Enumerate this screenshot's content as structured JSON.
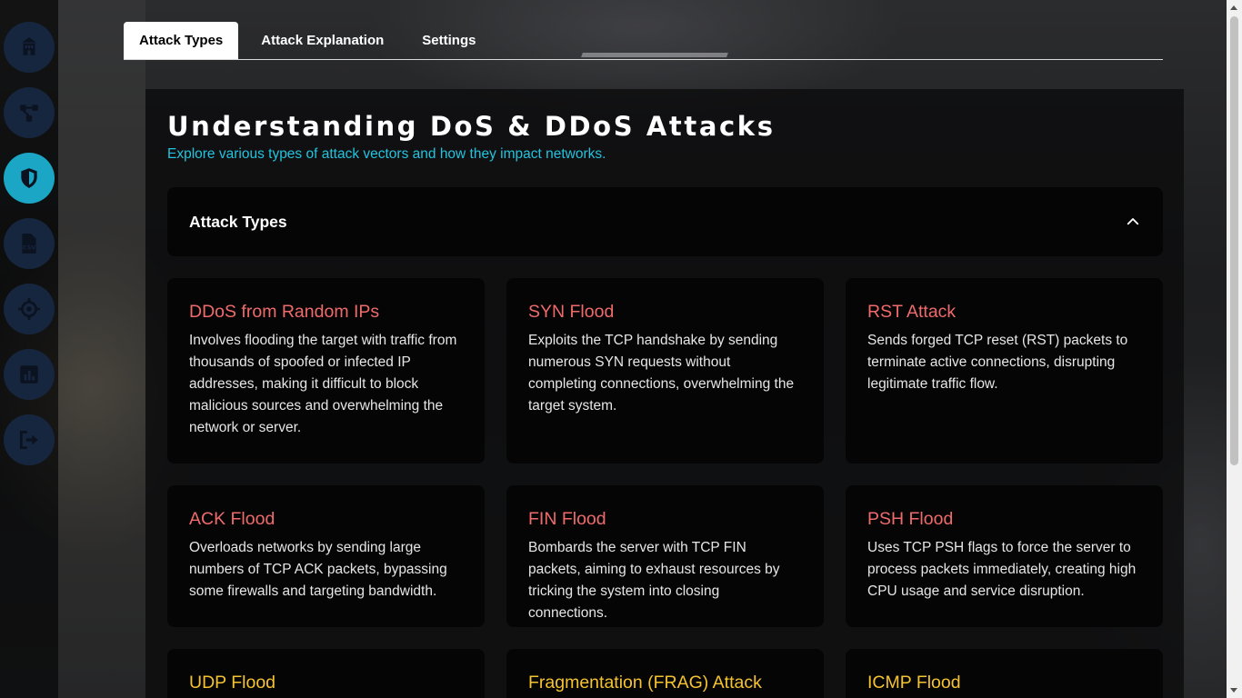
{
  "sidebar": {
    "items": [
      {
        "icon": "building-icon",
        "active": false
      },
      {
        "icon": "network-icon",
        "active": false
      },
      {
        "icon": "shield-icon",
        "active": true
      },
      {
        "icon": "csv-file-icon",
        "active": false
      },
      {
        "icon": "crosshair-icon",
        "active": false
      },
      {
        "icon": "bar-chart-icon",
        "active": false
      },
      {
        "icon": "logout-icon",
        "active": false
      }
    ]
  },
  "tabs": [
    {
      "label": "Attack Types",
      "active": true
    },
    {
      "label": "Attack Explanation",
      "active": false
    },
    {
      "label": "Settings",
      "active": false
    }
  ],
  "header": {
    "title": "Understanding DoS & DDoS Attacks",
    "subtitle": "Explore various types of attack vectors and how they impact networks."
  },
  "accordion": {
    "title": "Attack Types",
    "expanded": true
  },
  "cards": [
    {
      "title": "DDoS from Random IPs",
      "description": "Involves flooding the target with traffic from thousands of spoofed or infected IP addresses, making it difficult to block malicious sources and overwhelming the network or server."
    },
    {
      "title": "SYN Flood",
      "description": "Exploits the TCP handshake by sending numerous SYN requests without completing connections, overwhelming the target system."
    },
    {
      "title": "RST Attack",
      "description": "Sends forged TCP reset (RST) packets to terminate active connections, disrupting legitimate traffic flow."
    },
    {
      "title": "ACK Flood",
      "description": "Overloads networks by sending large numbers of TCP ACK packets, bypassing some firewalls and targeting bandwidth."
    },
    {
      "title": "FIN Flood",
      "description": "Bombards the server with TCP FIN packets, aiming to exhaust resources by tricking the system into closing connections."
    },
    {
      "title": "PSH Flood",
      "description": "Uses TCP PSH flags to force the server to process packets immediately, creating high CPU usage and service disruption."
    },
    {
      "title": "UDP Flood",
      "description": ""
    },
    {
      "title": "Fragmentation (FRAG) Attack",
      "description": ""
    },
    {
      "title": "ICMP Flood",
      "description": ""
    }
  ],
  "colors": {
    "accent": "#1aa6c4",
    "subtitle": "#23c3df",
    "card_title_red": "#ef6b6b",
    "card_title_yellow": "#f5c330",
    "sidebar_button": "#17263f"
  }
}
